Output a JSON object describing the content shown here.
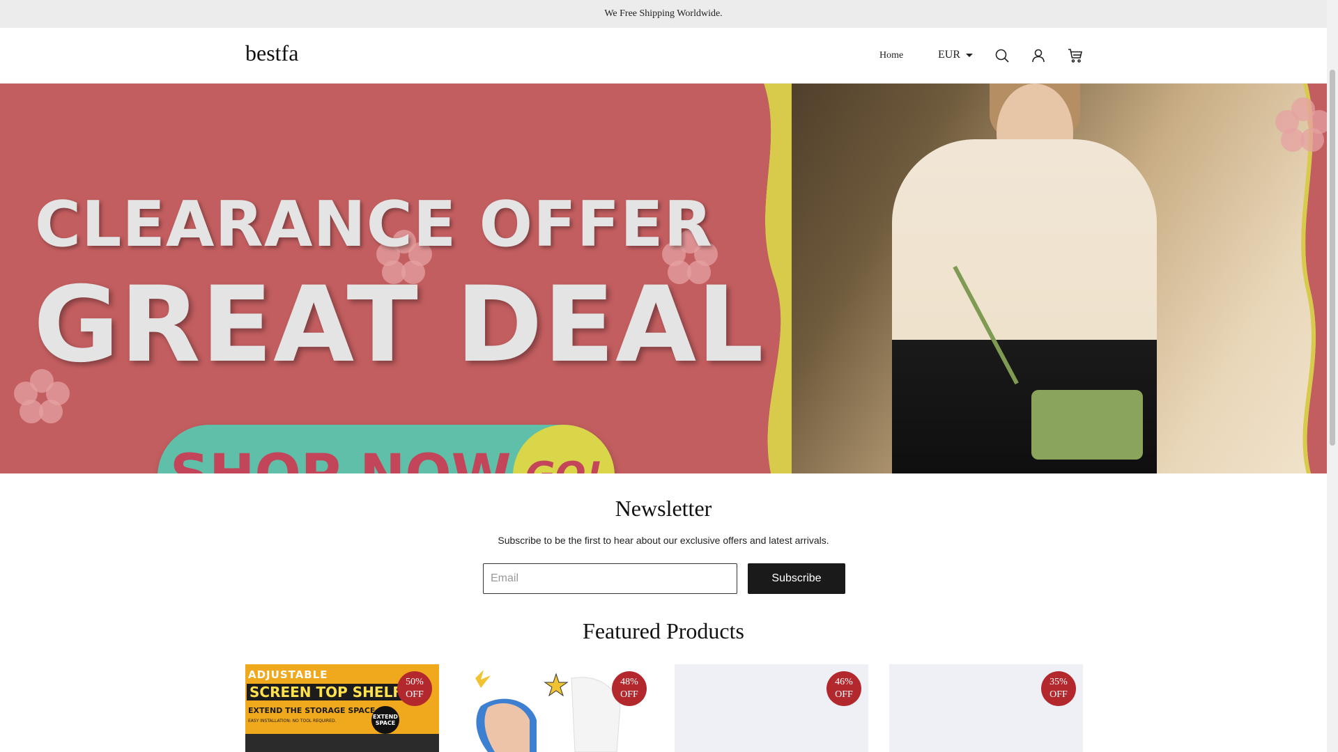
{
  "announcement": "We Free Shipping Worldwide.",
  "header": {
    "logo": "bestfa",
    "nav_home": "Home",
    "currency": "EUR",
    "icons": [
      "search-icon",
      "account-icon",
      "cart-icon"
    ]
  },
  "banner": {
    "line1": "CLEARANCE OFFER",
    "line2": "GREAT DEAL",
    "cta": "SHOP NOW",
    "go": "GO!",
    "colors": {
      "background": "#c35e60",
      "pill": "#5fbfa8",
      "go_circle": "#d9d64a",
      "text": "#e4e4e4",
      "cta_text": "#c3455a"
    }
  },
  "newsletter": {
    "title": "Newsletter",
    "subtitle": "Subscribe to be the first to hear about our exclusive offers and latest arrivals.",
    "email_placeholder": "Email",
    "button": "Subscribe"
  },
  "featured": {
    "title": "Featured Products",
    "products": [
      {
        "badge_pct": "50%",
        "badge_off": "OFF",
        "image_text": {
          "line1": "ADJUSTABLE",
          "line2": "SCREEN TOP SHELF",
          "line3": "EXTEND THE STORAGE SPACE",
          "line4": "EASY INSTALLATION: NO TOOL REQUIRED.",
          "seal": "EXTEND SPACE"
        }
      },
      {
        "badge_pct": "48%",
        "badge_off": "OFF"
      },
      {
        "badge_pct": "46%",
        "badge_off": "OFF"
      },
      {
        "badge_pct": "35%",
        "badge_off": "OFF"
      }
    ],
    "badge_color": "#b3282d"
  }
}
